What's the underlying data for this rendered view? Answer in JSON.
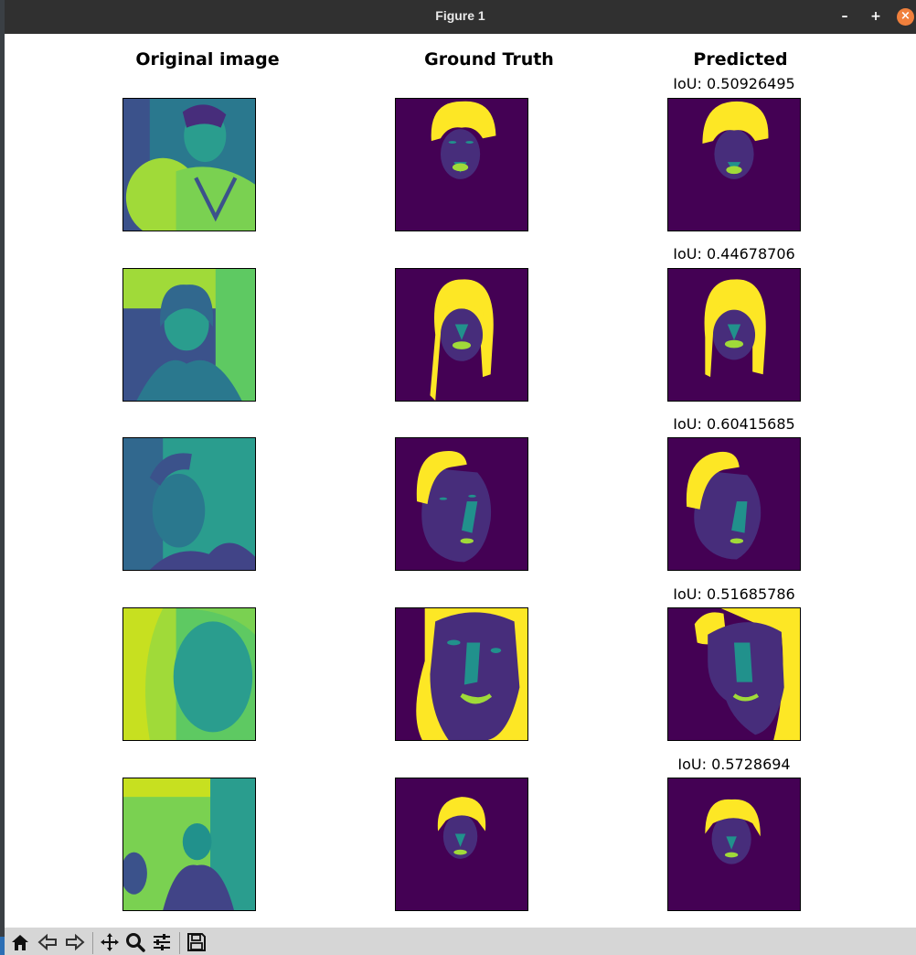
{
  "window": {
    "title": "Figure 1",
    "minimize_label": "–",
    "maximize_label": "+",
    "close_label": "×"
  },
  "figure": {
    "columns": [
      "Original image",
      "Ground Truth",
      "Predicted"
    ],
    "rows": [
      {
        "iou": "IoU: 0.50926495"
      },
      {
        "iou": "IoU: 0.44678706"
      },
      {
        "iou": "IoU: 0.60415685"
      },
      {
        "iou": "IoU: 0.51685786"
      },
      {
        "iou": "IoU: 0.5728694"
      }
    ],
    "colors": {
      "background": "#440154",
      "face": "#472d7b",
      "features": "#21918c",
      "mouth": "#a0da39",
      "hair": "#fde725",
      "photo_dark": "#3b528b",
      "photo_mid": "#2a9d8e",
      "photo_light": "#c7e020"
    }
  },
  "toolbar": {
    "icons": [
      "home-icon",
      "back-icon",
      "forward-icon",
      "pan-icon",
      "zoom-icon",
      "configure-subplots-icon",
      "save-icon"
    ]
  }
}
